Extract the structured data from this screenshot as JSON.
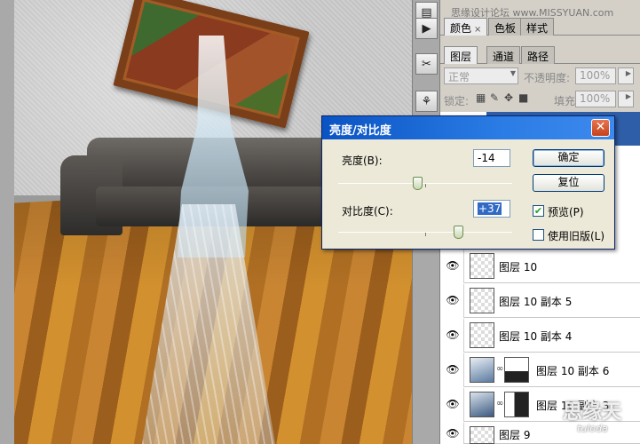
{
  "watermark": {
    "site": "思缘设计论坛 www.MISSYUAN.com",
    "logo": "思缘天",
    "logo_sub": "tuloda"
  },
  "panel": {
    "top_tabs": [
      {
        "label": "颜色"
      },
      {
        "label": "色板"
      },
      {
        "label": "样式"
      }
    ],
    "layer_tabs": [
      {
        "label": "图层"
      },
      {
        "label": "通道"
      },
      {
        "label": "路径"
      }
    ],
    "blend_mode": "正常",
    "opacity_label": "不透明度:",
    "opacity_value": "100%",
    "lock_label": "锁定:",
    "fill_label": "填充:",
    "fill_value": "100%"
  },
  "layers": [
    {
      "name": "图层 10",
      "has_mask": false
    },
    {
      "name": "图层 10 副本 5",
      "has_mask": false
    },
    {
      "name": "图层 10 副本 4",
      "has_mask": false
    },
    {
      "name": "图层 10 副本 6",
      "has_mask": true
    },
    {
      "name": "图层 10 副本 3",
      "has_mask": true
    },
    {
      "name": "图层 9",
      "has_mask": false
    }
  ],
  "dialog": {
    "title": "亮度/对比度",
    "brightness_label": "亮度(B):",
    "brightness_value": "-14",
    "contrast_label": "对比度(C):",
    "contrast_value": "+37",
    "ok_label": "确定",
    "reset_label": "复位",
    "preview_label": "预览(P)",
    "preview_checked": true,
    "legacy_label": "使用旧版(L)",
    "legacy_checked": false,
    "close_glyph": "✕"
  }
}
